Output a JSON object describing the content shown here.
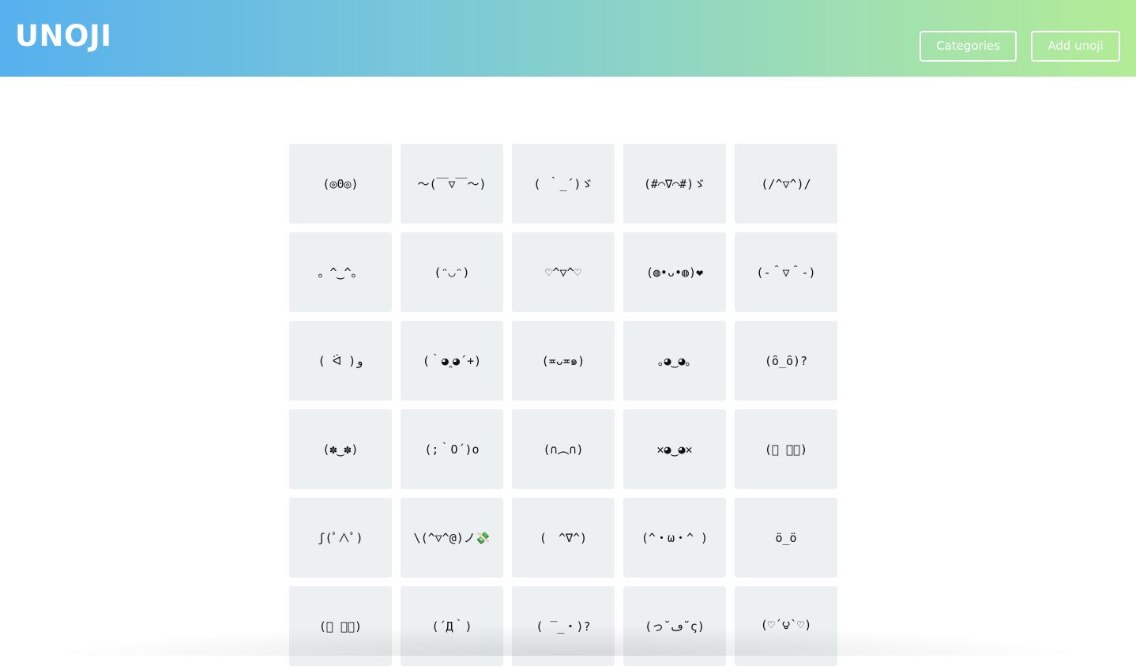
{
  "header": {
    "logo": "UNOJI",
    "categories_label": "Categories",
    "add_label": "Add unoji"
  },
  "colors": {
    "gradient_start": "#56b0ee",
    "gradient_end": "#b3ec96",
    "tile_bg": "#ecf0f1"
  },
  "unojis": [
    "(◎0◎)",
    "～(￣▽￣～)",
    "( ｀_´)ゞ",
    "(#⌒∇⌒#)ゞ",
    "(/^▽^)/",
    "。^‿^。",
    "(ᵔ◡ᵔ)",
    "♡^▽^♡",
    "(◍•ᴗ•◍)❤",
    "(-＾▽＾-)",
    "( ᐛ )و",
    "(｀◕‸◕´+)",
    "(≖ᴗ≖๑)",
    "｡◕‿◕｡",
    "(ȏ_ȏ)?",
    "(✽‿✽)",
    "(;｀O´)o",
    "(∩︵∩)",
    "✕◕‿◕✕",
    "(ﾟ ｡ﾟ)",
    "ʃ(ﾟ∧ﾟ)",
    "\\(^▽^@)ノ💸",
    "(　^∇^)",
    "(^・ω・^ )",
    "ö_ö",
    "(ﾟ ーﾟ)",
    "(´Д｀)",
    "( ‾_・)?",
    "(っ˘ڡ˘ς)",
    "(♡´౪`♡)"
  ]
}
